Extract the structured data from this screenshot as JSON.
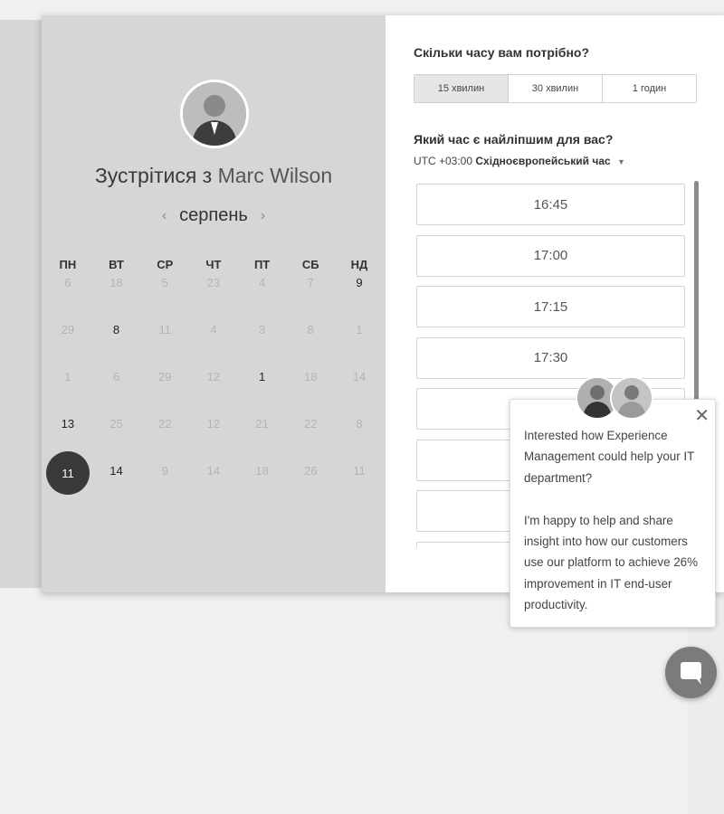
{
  "host": {
    "meet_prefix": "Зустрітися з",
    "name": "Marc Wilson"
  },
  "calendar": {
    "month": "серпень",
    "prev_icon": "chevron-left-icon",
    "next_icon": "chevron-right-icon",
    "weekdays": [
      "ПН",
      "ВТ",
      "СР",
      "ЧТ",
      "ПТ",
      "СБ",
      "НД"
    ],
    "rows": [
      [
        "6",
        "18",
        "5",
        "23",
        "4",
        "7",
        "9"
      ],
      [
        "29",
        "8",
        "11",
        "4",
        "3",
        "8",
        "1"
      ],
      [
        "1",
        "6",
        "29",
        "12",
        "1",
        "18",
        "14"
      ],
      [
        "13",
        "25",
        "22",
        "12",
        "21",
        "22",
        "8"
      ],
      [
        "11",
        "14",
        "9",
        "14",
        "18",
        "26",
        "11"
      ]
    ],
    "selected": "11"
  },
  "duration": {
    "question": "Скільки часу вам потрібно?",
    "options": [
      "15 хвилин",
      "30 хвилин",
      "1 годин"
    ]
  },
  "time": {
    "question": "Який час є найліпшим для вас?",
    "tz_offset": "UTC +03:00",
    "tz_name": "Східноєвропейський час",
    "slots": [
      "16:45",
      "17:00",
      "17:15",
      "17:30",
      "",
      "",
      "",
      ""
    ]
  },
  "popup": {
    "paragraph1": "Interested how Experience Management could help your IT department?",
    "paragraph2": "I'm happy to help and share insight into how our customers use our platform to achieve 26% improvement in IT end-user productivity."
  },
  "colors": {
    "left_pane": "#d6d6d6",
    "selected_day": "#3a3a3a",
    "chat_button": "#7b7b7b"
  }
}
